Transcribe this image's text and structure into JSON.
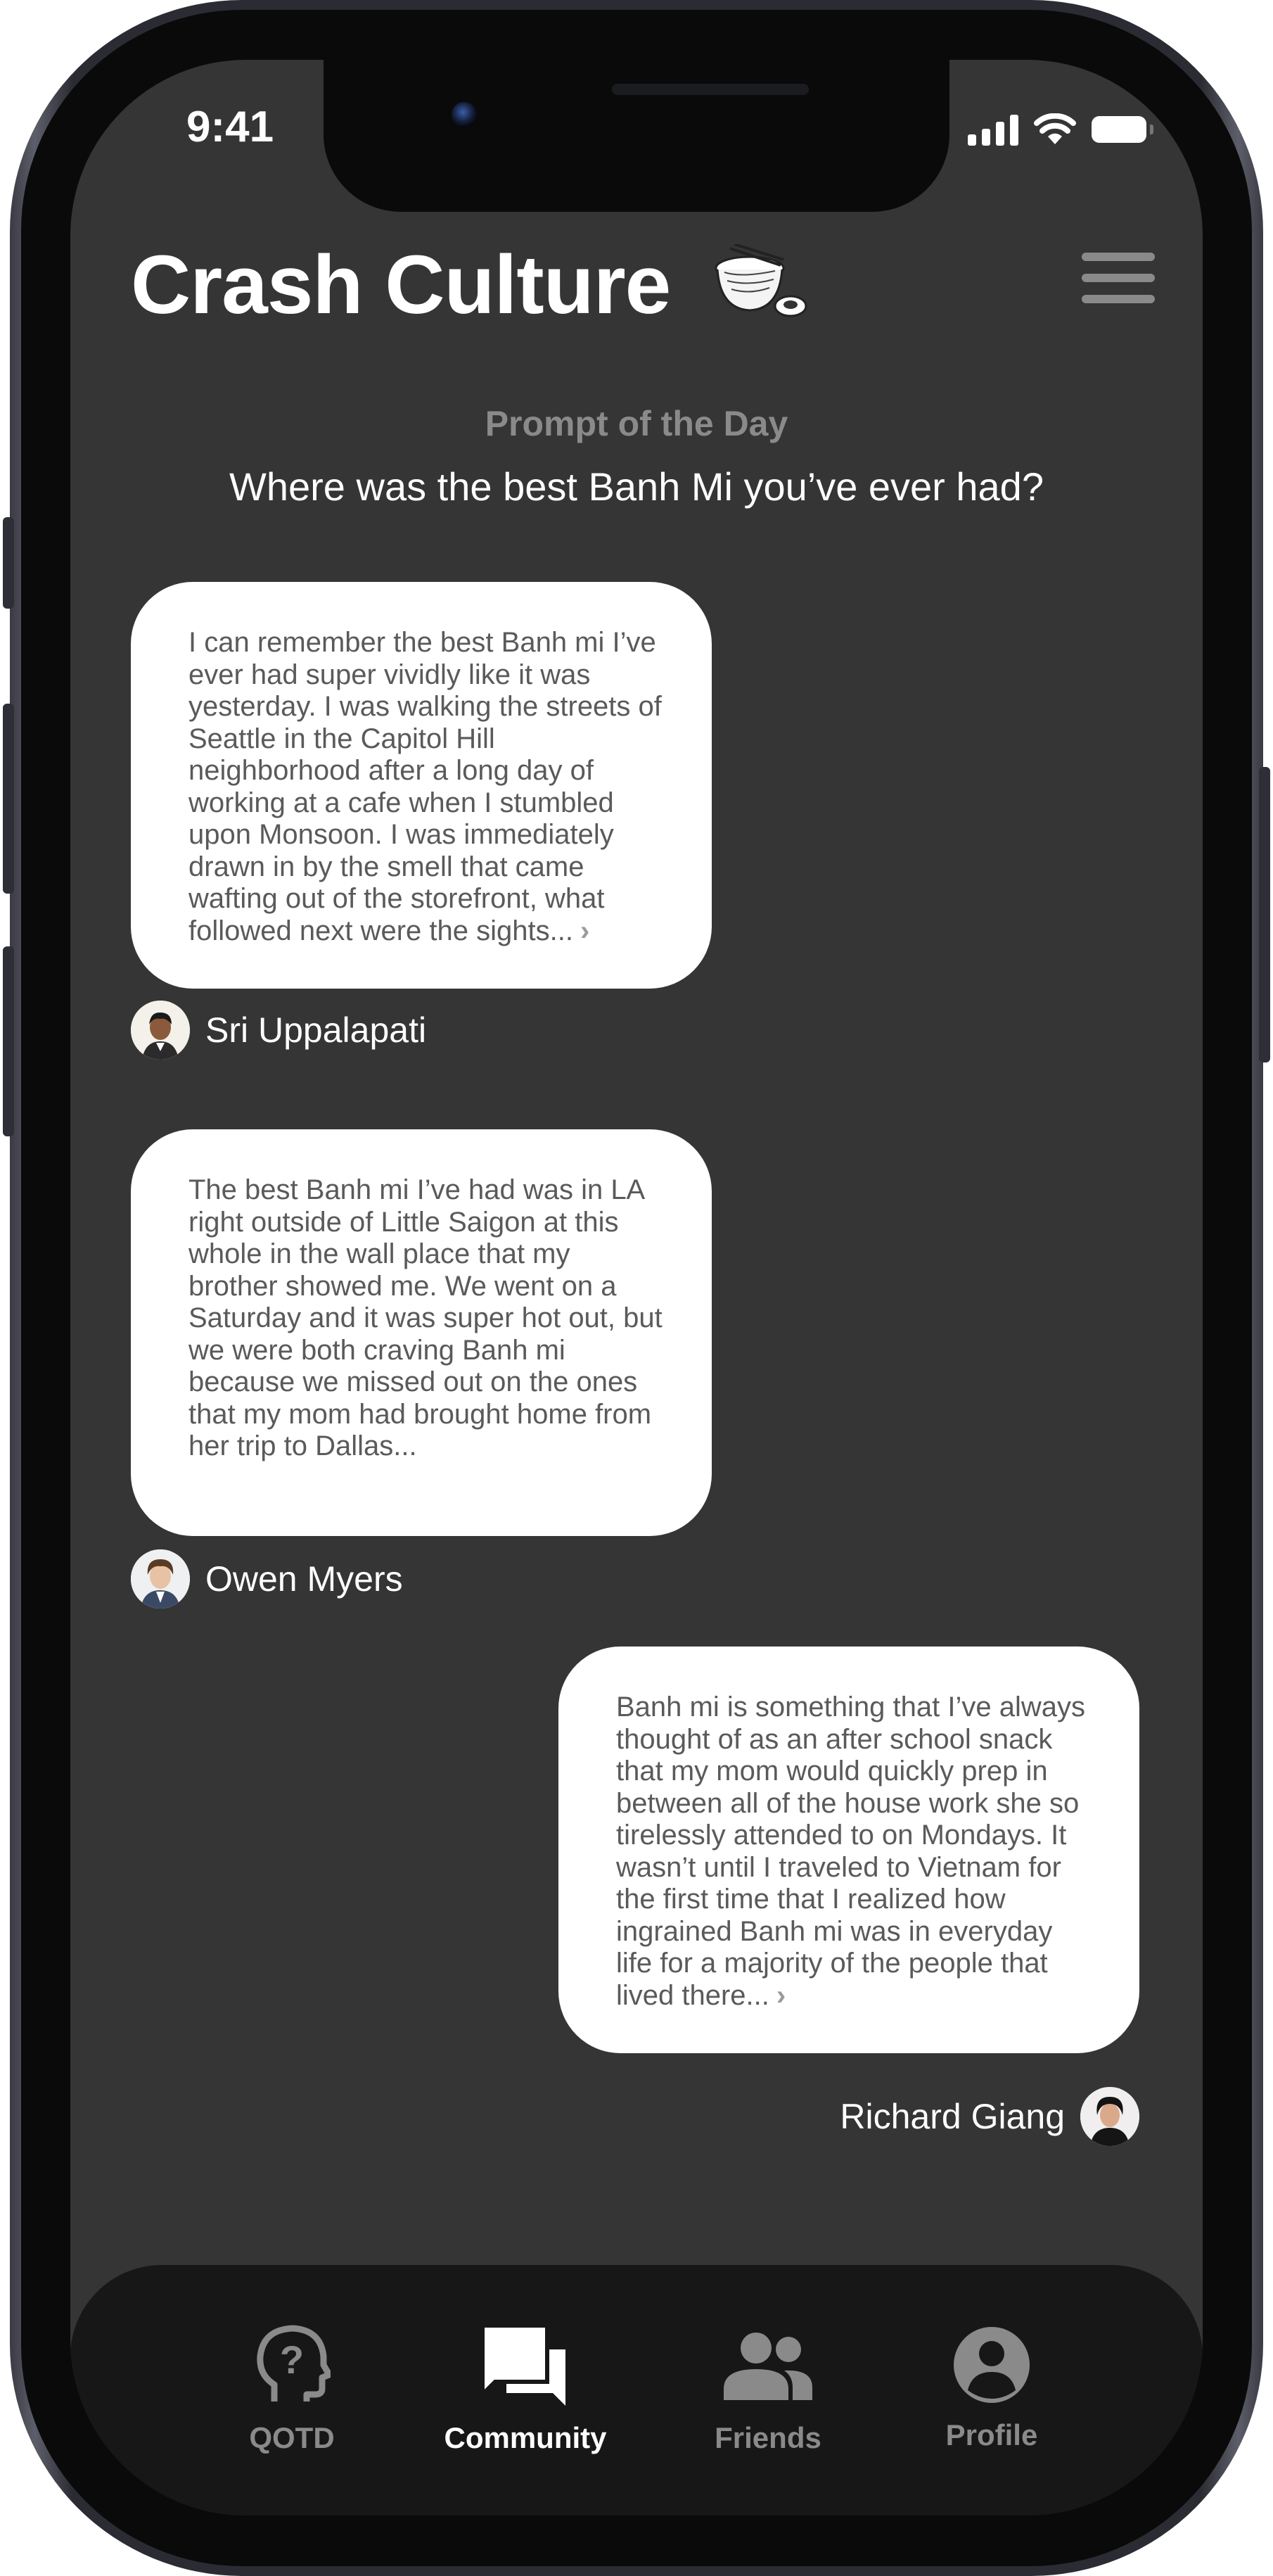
{
  "status_bar": {
    "time": "9:41"
  },
  "header": {
    "title": "Crash Culture"
  },
  "prompt": {
    "label": "Prompt of the Day",
    "question": "Where was the best Banh Mi you’ve ever had?"
  },
  "posts": [
    {
      "text": "I can remember the best Banh mi I’ve ever had super vividly like it was yesterday. I was walking the streets of Seattle in the Capitol Hill neighborhood after a long day of working at a cafe when I stumbled upon Monsoon. I was immediately drawn in by the smell that came wafting out of the storefront, what followed next were the sights...",
      "more": "›",
      "author": "Sri Uppalapati"
    },
    {
      "text": "The best Banh mi I’ve had was in LA right outside of Little Saigon at this whole in the wall place that my brother showed me. We went on a Saturday and it was super hot out, but we were both craving Banh mi because we missed out on the ones that my mom had brought home from her trip to Dallas...",
      "author": "Owen Myers"
    },
    {
      "text": "Banh mi is something that I’ve always thought of as an after school snack that my mom would quickly prep in between all of the house work she so tirelessly attended to on Mondays. It wasn’t until I traveled to Vietnam for the first time that I realized how ingrained Banh mi was in everyday life for a majority of the people that lived there...",
      "more": "›",
      "author": "Richard Giang"
    }
  ],
  "tabs": [
    {
      "label": "QOTD",
      "icon": "head-question-icon",
      "active": false
    },
    {
      "label": "Community",
      "icon": "chat-bubbles-icon",
      "active": true
    },
    {
      "label": "Friends",
      "icon": "people-icon",
      "active": false
    },
    {
      "label": "Profile",
      "icon": "account-circle-icon",
      "active": false
    }
  ],
  "colors": {
    "screen_bg": "#353535",
    "tab_bar_bg": "#171717",
    "bubble_bg": "#ffffff",
    "muted_text": "#8a8a8a",
    "active_tab": "#ffffff"
  }
}
